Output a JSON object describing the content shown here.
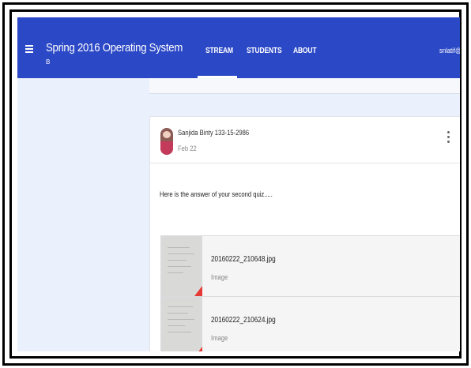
{
  "course": {
    "title": "Spring 2016 Operating System",
    "section": "B"
  },
  "tabs": {
    "stream": "STREAM",
    "students": "STUDENTS",
    "about": "ABOUT"
  },
  "user": {
    "email": "snlatif@c"
  },
  "post": {
    "author": "Sanjida Binty 133-15-2986",
    "date": "Feb 22",
    "text": "Here is the answer of your second quiz.....",
    "attachments": [
      {
        "name": "20160222_210648.jpg",
        "type": "Image"
      },
      {
        "name": "20160222_210624.jpg",
        "type": "Image"
      }
    ]
  }
}
